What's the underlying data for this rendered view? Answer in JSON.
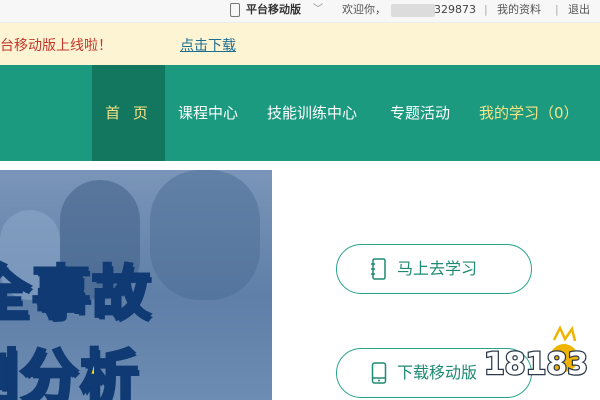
{
  "topbar": {
    "platform_label": "平台移动版",
    "welcome": "欢迎你，",
    "user_suffix": "329873",
    "separator": "|",
    "profile": "我的资料",
    "logout": "退出"
  },
  "notice": {
    "text": "台移动版上线啦！",
    "link": "点击下载"
  },
  "nav": {
    "home": "首 页",
    "courses": "课程中心",
    "skills": "技能训练中心",
    "topics": "专题活动",
    "mine": "我的学习（0）"
  },
  "hero": {
    "line1": "全事故",
    "line2": "例分析"
  },
  "actions": {
    "study": "马上去学习",
    "download": "下载移动版"
  },
  "watermark": {
    "text": "18183"
  },
  "colors": {
    "nav_bg": "#1b9a80",
    "nav_active_bg": "#13765f",
    "nav_highlight": "#f5e486",
    "notice_bg": "#fdf4d3",
    "notice_text": "#c0392b",
    "button_border": "#2aa38a",
    "hero_text": "#ffe400"
  },
  "icons": {
    "topbar_device": "phone-icon",
    "dropdown": "chevron-down-icon",
    "study": "notebook-icon",
    "download": "phone-icon"
  }
}
